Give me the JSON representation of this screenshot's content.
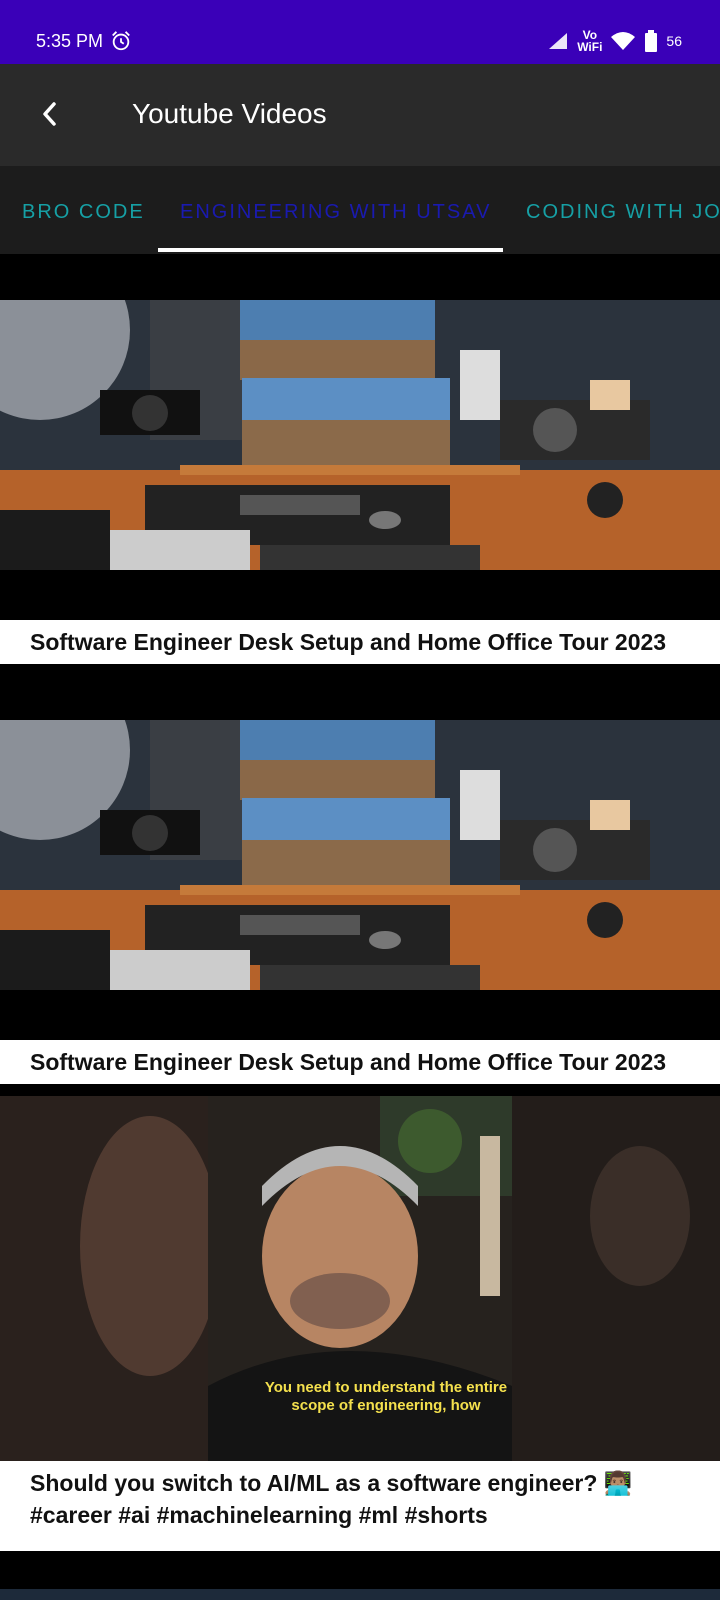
{
  "status": {
    "time": "5:35 PM",
    "network_label": "Vo\nWiFi",
    "battery": "56"
  },
  "app_bar": {
    "title": "Youtube Videos"
  },
  "tabs": [
    {
      "label": "BRO CODE"
    },
    {
      "label": "ENGINEERING WITH UTSAV"
    },
    {
      "label": "CODING WITH JOHN"
    }
  ],
  "videos": [
    {
      "title": "Software Engineer Desk Setup and Home Office Tour 2023"
    },
    {
      "title": "Software Engineer Desk Setup and Home Office Tour 2023"
    },
    {
      "title": "Should you switch to AI/ML as a software engineer? 👨🏽‍💻 #career #ai #machinelearning #ml #shorts",
      "overlay_text": "You need to understand the entire scope of engineering, how"
    }
  ],
  "colors": {
    "status_bar": "#3a00b8",
    "app_bar": "#2a2a2a",
    "tab_bar": "#1c1c1c",
    "tab_inactive": "#16a0a5",
    "tab_active": "#1a1ab0"
  },
  "icons": [
    "alarm-icon",
    "signal-icon",
    "wifi-icon",
    "battery-icon",
    "back-icon"
  ]
}
